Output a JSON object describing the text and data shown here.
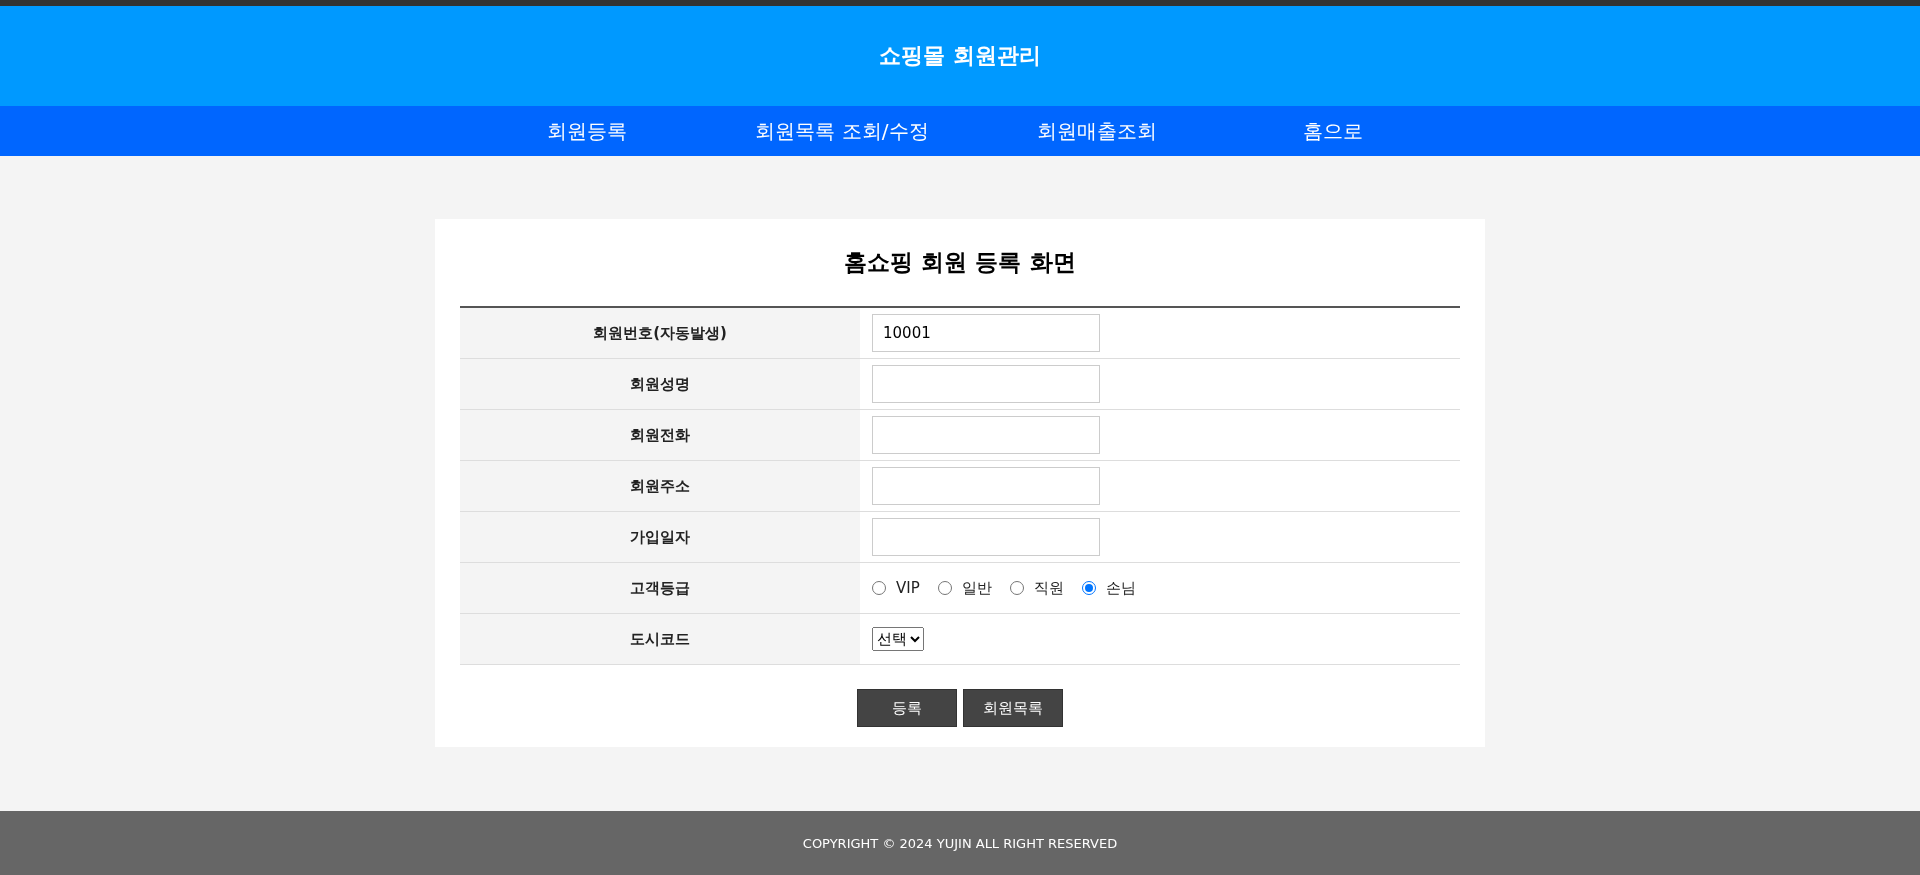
{
  "header": {
    "title": "쇼핑몰 회원관리"
  },
  "nav": [
    "회원등록",
    "회원목록 조회/수정",
    "회원매출조회",
    "홈으로"
  ],
  "form": {
    "title": "홈쇼핑 회원 등록 화면",
    "rows": [
      {
        "kind": "text",
        "label": "회원번호(자동발생)",
        "value": "10001"
      },
      {
        "kind": "text",
        "label": "회원성명",
        "value": ""
      },
      {
        "kind": "text",
        "label": "회원전화",
        "value": ""
      },
      {
        "kind": "text",
        "label": "회원주소",
        "value": ""
      },
      {
        "kind": "text",
        "label": "가입일자",
        "value": ""
      },
      {
        "kind": "radio",
        "label": "고객등급",
        "options": [
          {
            "label": "VIP",
            "selected": false
          },
          {
            "label": "일반",
            "selected": false
          },
          {
            "label": "직원",
            "selected": false
          },
          {
            "label": "손님",
            "selected": true
          }
        ]
      },
      {
        "kind": "select",
        "label": "도시코드",
        "value": "선택"
      }
    ],
    "buttons": [
      "등록",
      "회원목록"
    ]
  },
  "footer": "COPYRIGHT © 2024 YUJIN ALL RIGHT RESERVED"
}
